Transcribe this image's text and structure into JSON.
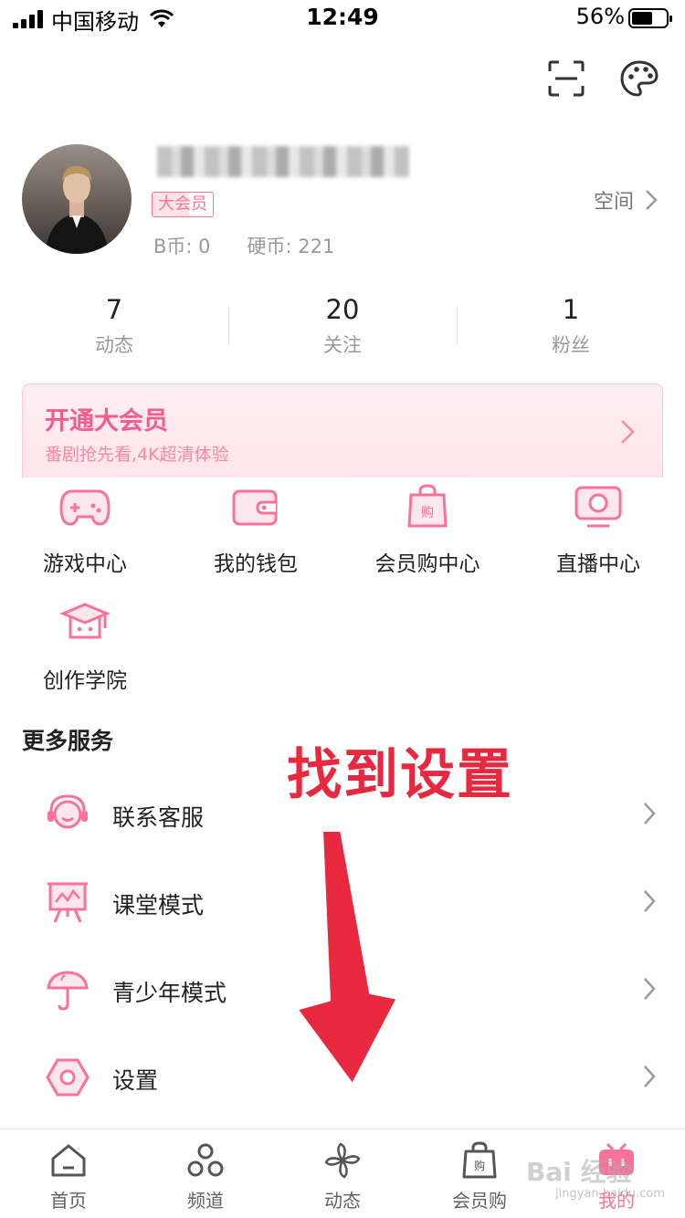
{
  "status_bar": {
    "carrier": "中国移动",
    "time": "12:49",
    "battery": "56%"
  },
  "header": {
    "icons": [
      "scan-icon",
      "palette-icon"
    ]
  },
  "profile": {
    "vip_badge": "大会员",
    "b_coin": "B币: 0",
    "hard_coin": "硬币: 221",
    "space_link": "空间"
  },
  "stats": [
    {
      "value": "7",
      "label": "动态"
    },
    {
      "value": "20",
      "label": "关注"
    },
    {
      "value": "1",
      "label": "粉丝"
    }
  ],
  "vip_banner": {
    "title": "开通大会员",
    "subtitle": "番剧抢先看,4K超清体验"
  },
  "services": [
    {
      "label": "游戏中心",
      "icon": "gamepad-icon"
    },
    {
      "label": "我的钱包",
      "icon": "wallet-icon"
    },
    {
      "label": "会员购中心",
      "icon": "shopping-bag-icon"
    },
    {
      "label": "直播中心",
      "icon": "live-tv-icon"
    },
    {
      "label": "创作学院",
      "icon": "graduation-cap-icon"
    }
  ],
  "more_services": {
    "title": "更多服务",
    "items": [
      {
        "label": "联系客服",
        "icon": "headset-icon"
      },
      {
        "label": "课堂模式",
        "icon": "presentation-board-icon"
      },
      {
        "label": "青少年模式",
        "icon": "umbrella-icon"
      },
      {
        "label": "设置",
        "icon": "settings-hexagon-icon"
      }
    ]
  },
  "annotation": {
    "text": "找到设置"
  },
  "tab_bar": [
    {
      "label": "首页",
      "icon": "home-icon"
    },
    {
      "label": "频道",
      "icon": "channels-icon"
    },
    {
      "label": "动态",
      "icon": "pinwheel-icon"
    },
    {
      "label": "会员购",
      "icon": "shopping-bag-icon"
    },
    {
      "label": "我的",
      "icon": "bilibili-tv-icon",
      "active": true
    }
  ],
  "watermark": {
    "text": "Bai 经验",
    "sub": "jingyan.baidu.com"
  },
  "colors": {
    "accent": "#fb7299",
    "annotation": "#e8283e",
    "text": "#212121",
    "muted": "#9a9a9a"
  }
}
